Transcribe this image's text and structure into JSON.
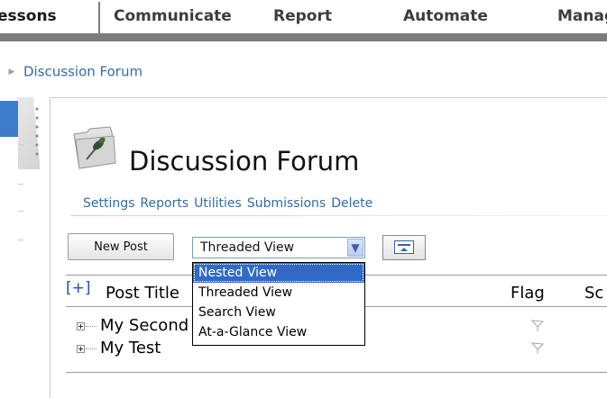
{
  "tabs": [
    {
      "label": "essons",
      "active": true
    },
    {
      "label": "Communicate",
      "active": false
    },
    {
      "label": "Report",
      "active": false
    },
    {
      "label": "Automate",
      "active": false
    },
    {
      "label": "Manag",
      "active": false
    }
  ],
  "breadcrumb": {
    "items": [
      "Discussion Forum"
    ]
  },
  "page": {
    "title": "Discussion Forum",
    "actions": [
      "Settings",
      "Reports",
      "Utilities",
      "Submissions",
      "Delete"
    ]
  },
  "toolbar": {
    "new_post_label": "New Post",
    "view_select": {
      "selected": "Threaded View",
      "options": [
        "Nested View",
        "Threaded View",
        "Search View",
        "At-a-Glance View"
      ],
      "highlighted": "Nested View"
    }
  },
  "table": {
    "expand_all_label": "[+]",
    "columns": {
      "title": "Post Title",
      "flag": "Flag",
      "score": "Sc"
    },
    "rows": [
      {
        "title": "My Second"
      },
      {
        "title": "My Test"
      }
    ]
  },
  "colors": {
    "link": "#2f6ea5",
    "tab_bar": "#7c7c7c",
    "selection": "#316ac5",
    "rail_accent": "#3d7cc9"
  },
  "icons": {
    "folder": "pushpin-folder-icon",
    "collapse": "collapse-panel-icon",
    "flag": "flag-outline-icon",
    "tree_expand": "tree-plus-icon",
    "breadcrumb_arrow": "triangle-right-icon",
    "select_arrow": "chevron-down-icon"
  }
}
